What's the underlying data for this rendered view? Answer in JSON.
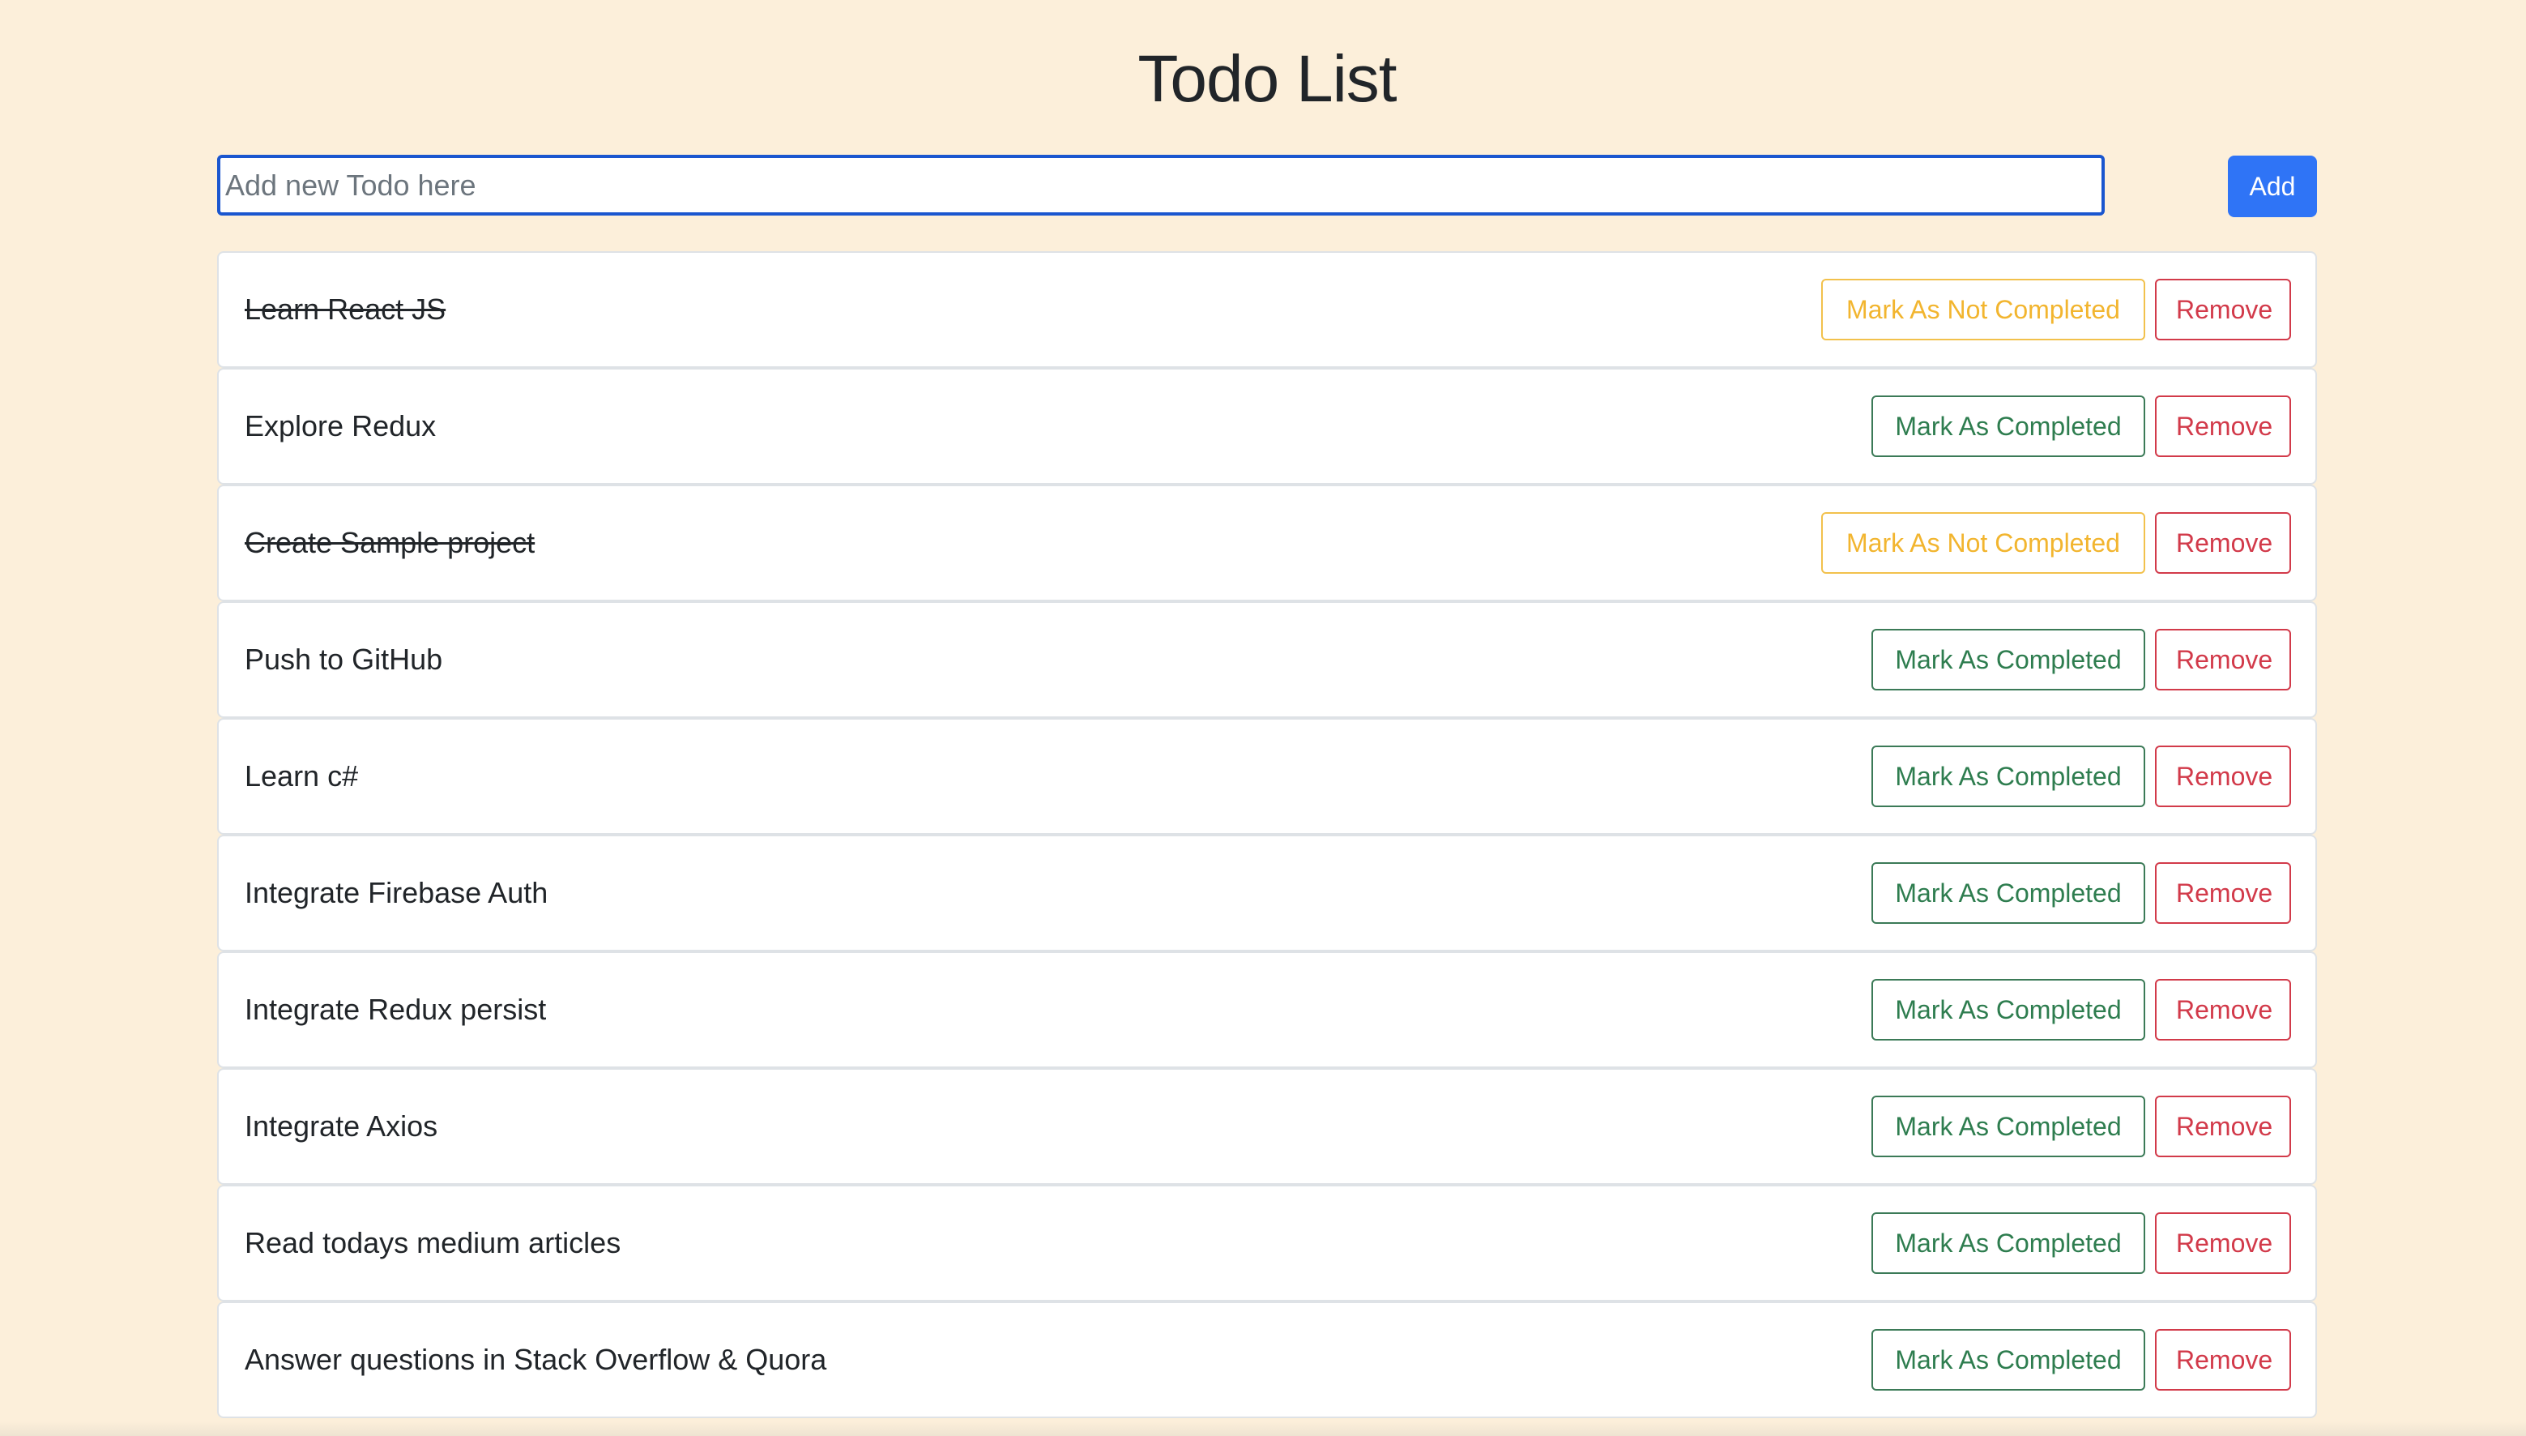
{
  "header": {
    "title": "Todo List"
  },
  "new_todo": {
    "placeholder": "Add new Todo here",
    "value": "",
    "add_label": "Add"
  },
  "todos": [
    {
      "text": "Learn React JS",
      "completed": true,
      "toggle_label": "Mark As Not Completed",
      "remove_label": "Remove"
    },
    {
      "text": "Explore Redux",
      "completed": false,
      "toggle_label": "Mark As Completed",
      "remove_label": "Remove"
    },
    {
      "text": "Create Sample project",
      "completed": true,
      "toggle_label": "Mark As Not Completed",
      "remove_label": "Remove"
    },
    {
      "text": "Push to GitHub",
      "completed": false,
      "toggle_label": "Mark As Completed",
      "remove_label": "Remove"
    },
    {
      "text": "Learn c#",
      "completed": false,
      "toggle_label": "Mark As Completed",
      "remove_label": "Remove"
    },
    {
      "text": "Integrate Firebase Auth",
      "completed": false,
      "toggle_label": "Mark As Completed",
      "remove_label": "Remove"
    },
    {
      "text": "Integrate Redux persist",
      "completed": false,
      "toggle_label": "Mark As Completed",
      "remove_label": "Remove"
    },
    {
      "text": "Integrate Axios",
      "completed": false,
      "toggle_label": "Mark As Completed",
      "remove_label": "Remove"
    },
    {
      "text": "Read todays medium articles",
      "completed": false,
      "toggle_label": "Mark As Completed",
      "remove_label": "Remove"
    },
    {
      "text": "Answer questions in Stack Overflow & Quora",
      "completed": false,
      "toggle_label": "Mark As Completed",
      "remove_label": "Remove"
    }
  ],
  "colors": {
    "background": "#fcefda",
    "primary": "#2f74f6",
    "warning": "#f2b52f",
    "success": "#2e7d4f",
    "danger": "#d23a4a"
  }
}
